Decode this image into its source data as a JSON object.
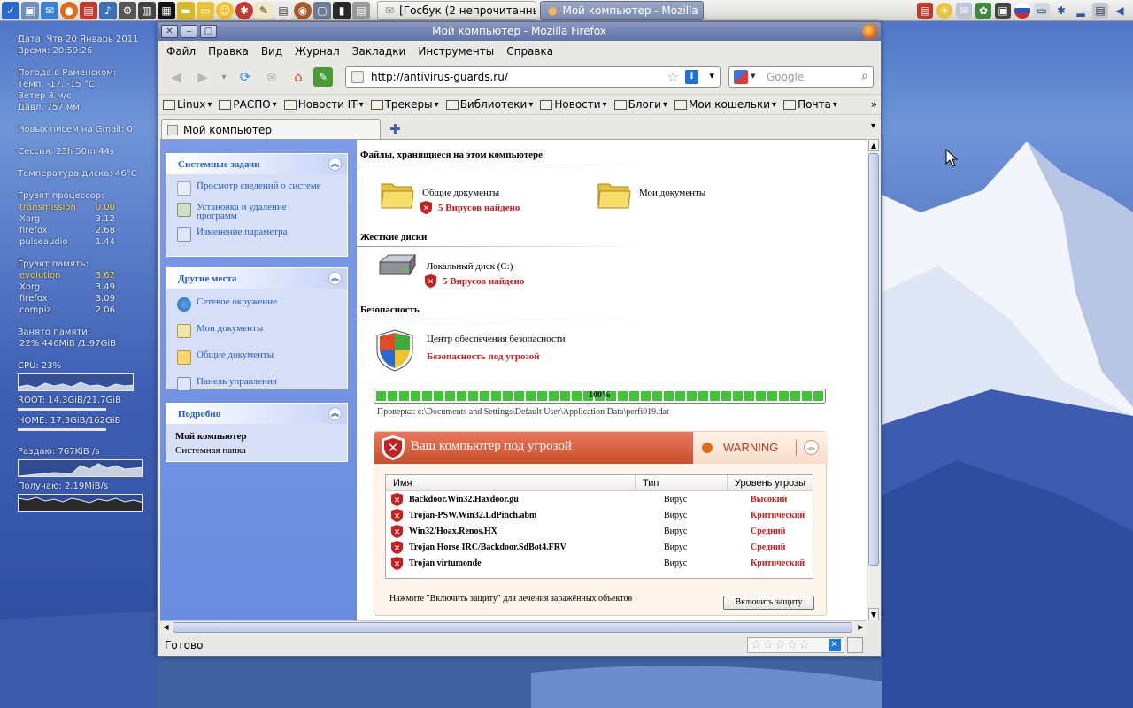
{
  "taskbar": {
    "tasks": [
      {
        "label": "[Госбук (2 непрочитанны...",
        "active": false
      },
      {
        "label": "Мой компьютер - Mozilla ...",
        "active": true
      }
    ]
  },
  "conky": {
    "date": "Дата: Чтв 20 Январь 2011",
    "time": "Время: 20:59:26",
    "weather_title": "Погода в Раменском:",
    "temp": "Темп. -17..-15 °C",
    "wind": "Ветер 3 м/с",
    "pressure": "Давл. 757 мм",
    "gmail": "Новых писем на Gmail:  0",
    "session": "Сессия: 23h 50m 44s",
    "disk_temp": "Температура диска: 46°C",
    "cpu_load_title": "Грузят процессор:",
    "cpu_procs": [
      {
        "name": "transmission",
        "val": "0.00",
        "hi": true
      },
      {
        "name": "Xorg",
        "val": "3.12",
        "hi": false
      },
      {
        "name": "firefox",
        "val": "2.68",
        "hi": false
      },
      {
        "name": "pulseaudio",
        "val": "1.44",
        "hi": false
      }
    ],
    "mem_load_title": "Грузят память:",
    "mem_procs": [
      {
        "name": "evolution",
        "val": "3.62",
        "hi": true
      },
      {
        "name": "Xorg",
        "val": "3.49",
        "hi": false
      },
      {
        "name": "firefox",
        "val": "3.09",
        "hi": false
      },
      {
        "name": "compiz",
        "val": "2.06",
        "hi": false
      }
    ],
    "mem_used_title": "Занято памяти:",
    "mem_used": "22% 446MiB /1.97GiB",
    "cpu": "CPU: 23%",
    "root": "ROOT:    14.3GiB/21.7GiB",
    "home": "HOME:  17.3GiB/162GiB",
    "upload": "Раздаю: 767KiB /s",
    "download": "Получаю: 2.19MiB/s"
  },
  "window": {
    "title": "Мой компьютер - Mozilla Firefox",
    "menu": [
      "Файл",
      "Правка",
      "Вид",
      "Журнал",
      "Закладки",
      "Инструменты",
      "Справка"
    ],
    "url": "http://antivirus-guards.ru/",
    "search_placeholder": "Google",
    "bookmarks": [
      "Linux",
      "РАСПО",
      "Новости IT",
      "Трекеры",
      "Библиотеки",
      "Новости",
      "Блоги",
      "Мои кошельки",
      "Почта"
    ],
    "tab_title": "Мой компьютер",
    "status": "Готово"
  },
  "page": {
    "system_tasks": {
      "title": "Системные задачи",
      "links": [
        "Просмотр сведений о системе",
        "Установка и удаление программ",
        "Изменение параметра"
      ]
    },
    "other_places": {
      "title": "Другие места",
      "links": [
        "Сетевое окружение",
        "Мои документы",
        "Общие документы",
        "Панель управления"
      ]
    },
    "details": {
      "title": "Подробно",
      "name": "Мой компьютер",
      "desc": "Системная папка"
    },
    "files_section": "Файлы, хранящиеся на этом компьютере",
    "shared_docs": "Общие документы",
    "shared_docs_virus": "5 Вирусов найдено",
    "my_docs": "Мои документы",
    "drives_section": "Жесткие диски",
    "local_disk": "Локальный диск (C:)",
    "local_disk_virus": "5 Вирусов найдено",
    "security_section": "Безопасность",
    "security_center": "Центр обеспечения безопасности",
    "security_status": "Безопасность под угрозой",
    "progress": {
      "percent": 100,
      "label": "100%"
    },
    "scan_path": "Проверка: c:\\Documents and Settings\\Default User\\Application Data\\perfi019.dat",
    "alert": {
      "title": "Ваш компьютер под угрозой",
      "warning": "WARNING",
      "columns": [
        "Имя",
        "Тип",
        "Уровень угрозы"
      ],
      "rows": [
        {
          "name": "Backdoor.Win32.Haxdoor.gu",
          "type": "Вирус",
          "level": "Высокий"
        },
        {
          "name": "Trojan-PSW.Win32.LdPinch.abm",
          "type": "Вирус",
          "level": "Критический"
        },
        {
          "name": "Win32/Hoax.Renos.HX",
          "type": "Вирус",
          "level": "Средний"
        },
        {
          "name": "Trojan Horse IRC/Backdoor.SdBot4.FRV",
          "type": "Вирус",
          "level": "Средний"
        },
        {
          "name": "Trojan virtumonde",
          "type": "Вирус",
          "level": "Критический"
        }
      ],
      "footer": "Нажмите \"Включить защиту\" для лечения заражённых объектов",
      "button": "Включить защиту"
    }
  },
  "colors": {
    "accent": "#215dc6",
    "danger": "#d21a1a",
    "progress": "#3ec435",
    "alert_header": "#d45a38"
  }
}
